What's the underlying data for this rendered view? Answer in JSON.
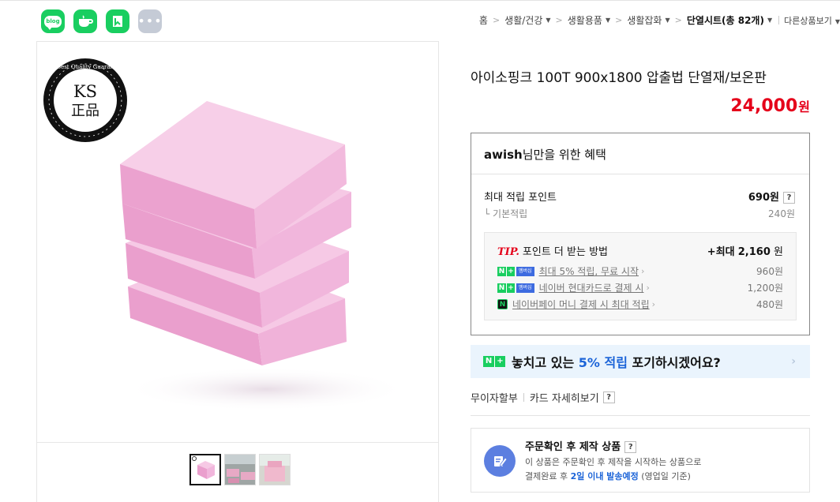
{
  "share": {
    "blog_label": "blog",
    "icons": [
      "blog-icon",
      "cafe-icon",
      "band-icon",
      "more-icon"
    ]
  },
  "breadcrumb": {
    "items": [
      "홈",
      "생활/건강",
      "생활용품",
      "생활잡화"
    ],
    "current": "단열시트(총 82개)",
    "other": "다른상품보기"
  },
  "gallery": {
    "badge_top": "The Best Quality Guaranteed",
    "badge_main": "KS",
    "badge_sub": "正品"
  },
  "product": {
    "title": "아이소핑크 100T 900x1800 압출법 단열재/보온판",
    "price": "24,000",
    "price_unit": "원"
  },
  "benefit": {
    "user": "awish",
    "header_rest": "님만을 위한 혜택",
    "max_label": "최대 적립 포인트",
    "max_value": "690원",
    "base_label": "└ 기본적립",
    "base_value": "240원",
    "tip_label": "TIP.",
    "tip_text": "포인트 더 받는 방법",
    "tip_max_prefix": "+최대",
    "tip_max_value": "2,160",
    "tip_max_unit": "원",
    "membership_badge": "멤버십",
    "rows": [
      {
        "label": "최대 5% 적립, 무료 시작",
        "value": "960원"
      },
      {
        "label": "네이버 현대카드로 결제 시",
        "value": "1,200원"
      },
      {
        "label": "네이버페이 머니 결제 시 최대 적립",
        "value": "480원"
      }
    ]
  },
  "promo": {
    "before": "놓치고 있는",
    "highlight": "5% 적립",
    "after": "포기하시겠어요?"
  },
  "links": {
    "installment": "무이자할부",
    "card_details": "카드 자세히보기"
  },
  "order": {
    "title": "주문확인 후 제작 상품",
    "desc1": "이 상품은 주문확인 후 제작을 시작하는 상품으로",
    "desc2_pre": "결제완료 후",
    "desc2_hl": "2일 이내 발송예정",
    "desc2_post": "(영업일 기준)"
  },
  "colors": {
    "price": "#e5001a",
    "naver_green": "#19ce60",
    "promo_bg": "#eaf4fd",
    "highlight_blue": "#1c64d8",
    "foam_pink": "#f2b8dc"
  }
}
